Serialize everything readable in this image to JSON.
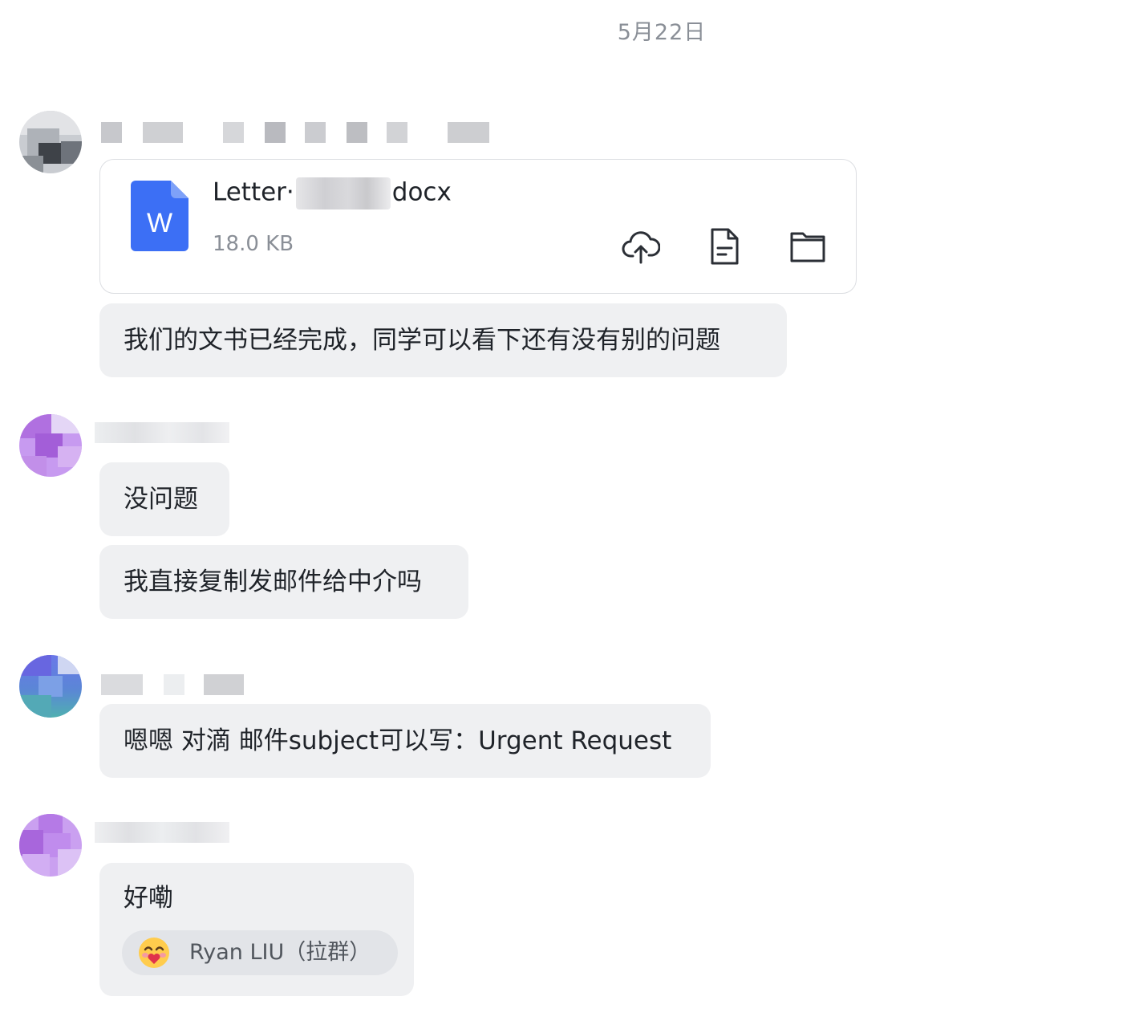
{
  "timeline": {
    "date": "5月22日"
  },
  "messages": [
    {
      "file": {
        "name_prefix": "Letter·",
        "name_suffix": "docx",
        "size": "18.0 KB",
        "icon_letter": "W",
        "icon_color": "#3c6ff5"
      },
      "text": "我们的文书已经完成，同学可以看下还有没有别的问题"
    },
    {
      "texts": [
        "没问题",
        "我直接复制发邮件给中介吗"
      ]
    },
    {
      "text": "嗯嗯 对滴 邮件subject可以写：Urgent Request"
    },
    {
      "text": "好嘞",
      "mention": {
        "name": "Ryan LIU（拉群）"
      }
    }
  ],
  "colors": {
    "bubble_bg": "#eff0f2",
    "text_primary": "#1f2329",
    "text_secondary": "#8a8f97",
    "card_border": "#dcdee2",
    "avatar_purple": "#b37fe0",
    "avatar_blue_teal": "#5a7fe0"
  },
  "icons": [
    "cloud-upload-icon",
    "document-icon",
    "folder-icon",
    "word-file-icon",
    "smiling-emoji-icon"
  ]
}
